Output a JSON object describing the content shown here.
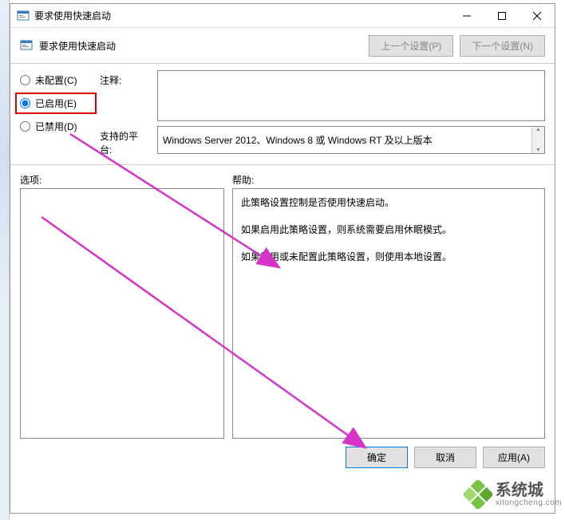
{
  "window": {
    "title": "要求使用快速启动"
  },
  "subheader": {
    "title": "要求使用快速启动",
    "nav_prev": "上一个设置(P)",
    "nav_next": "下一个设置(N)"
  },
  "radios": {
    "not_configured": "未配置(C)",
    "enabled": "已启用(E)",
    "disabled": "已禁用(D)"
  },
  "labels": {
    "comment": "注释:",
    "platform": "支持的平台:",
    "options": "选项:",
    "help": "帮助:"
  },
  "platform_text": "Windows Server 2012、Windows 8 或 Windows RT 及以上版本",
  "help_text": {
    "p1": "此策略设置控制是否使用快速启动。",
    "p2": "如果启用此策略设置，则系统需要启用休眠模式。",
    "p3": "如果禁用或未配置此策略设置，则使用本地设置。"
  },
  "buttons": {
    "ok": "确定",
    "cancel": "取消",
    "apply": "应用(A)"
  },
  "watermark": {
    "cn": "系统城",
    "en": "xitongcheng.com"
  }
}
